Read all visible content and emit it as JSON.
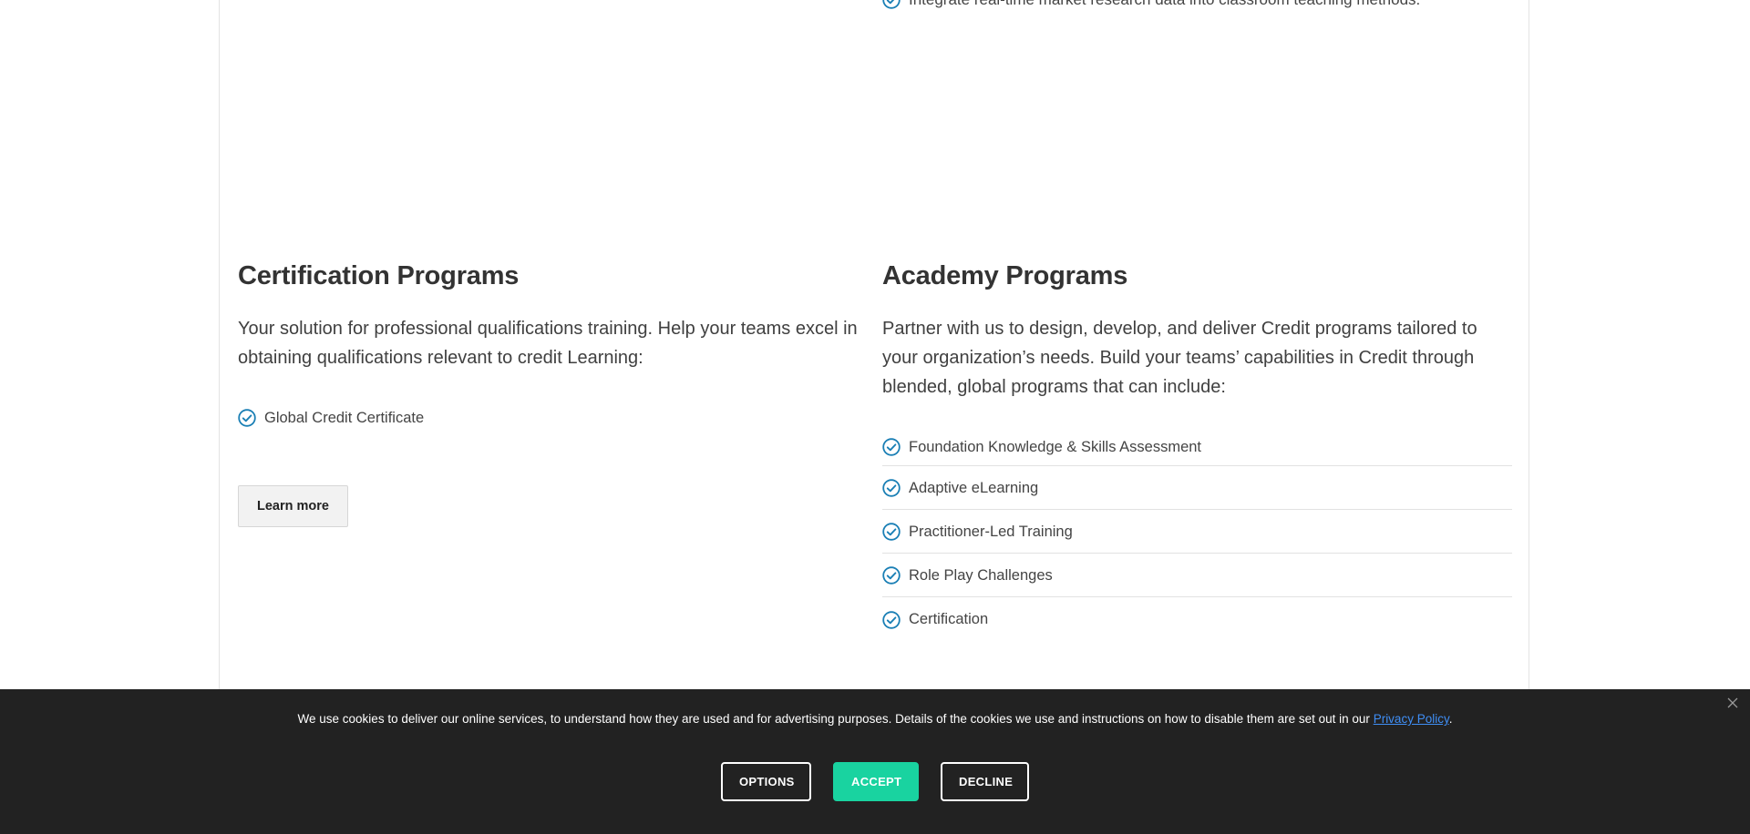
{
  "top_item": {
    "label": "Integrate real-time market research data into classroom teaching methods."
  },
  "certification": {
    "title": "Certification Programs",
    "description": "Your solution for professional qualifications training. Help your teams excel in obtaining qualifications relevant to credit Learning:",
    "items": [
      {
        "label": "Global Credit Certificate"
      }
    ],
    "button_label": "Learn more"
  },
  "academy": {
    "title": "Academy Programs",
    "description": "Partner with us to design, develop, and deliver Credit programs tailored to your organization’s needs. Build your teams’ capabilities in Credit through blended, global programs that can include:",
    "items": [
      {
        "label": "Foundation Knowledge & Skills Assessment"
      },
      {
        "label": "Adaptive eLearning"
      },
      {
        "label": "Practitioner-Led Training"
      },
      {
        "label": "Role Play Challenges"
      },
      {
        "label": "Certification"
      }
    ]
  },
  "cookie_banner": {
    "text": "We use cookies to deliver our online services, to understand how they are used and for advertising purposes. Details of the cookies we use and instructions on how to disable them are set out in our ",
    "link_label": "Privacy Policy",
    "text_end": ".",
    "options_label": "OPTIONS",
    "accept_label": "ACCEPT",
    "decline_label": "DECLINE"
  },
  "colors": {
    "check_icon": "#1a7fb5",
    "accept_button": "#19d3a0",
    "cookie_background": "#222222",
    "link": "#3f8ef5"
  }
}
